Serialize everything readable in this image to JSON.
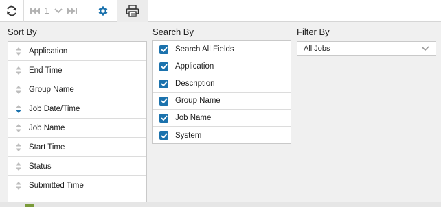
{
  "toolbar": {
    "page_number": "1",
    "icons": [
      "refresh-icon",
      "first-page-icon",
      "page-dropdown-icon",
      "last-page-icon",
      "gear-icon",
      "printer-icon"
    ],
    "accent_color": "#1b72ad"
  },
  "sort": {
    "title": "Sort By",
    "items": [
      {
        "label": "Application",
        "active": false
      },
      {
        "label": "End Time",
        "active": false
      },
      {
        "label": "Group Name",
        "active": false
      },
      {
        "label": "Job Date/Time",
        "active": true,
        "direction": "descending"
      },
      {
        "label": "Job Name",
        "active": false
      },
      {
        "label": "Start Time",
        "active": false
      },
      {
        "label": "Status",
        "active": false
      },
      {
        "label": "Submitted Time",
        "active": false
      }
    ]
  },
  "search": {
    "title": "Search By",
    "items": [
      {
        "label": "Search All Fields",
        "checked": true
      },
      {
        "label": "Application",
        "checked": true
      },
      {
        "label": "Description",
        "checked": true
      },
      {
        "label": "Group Name",
        "checked": true
      },
      {
        "label": "Job Name",
        "checked": true
      },
      {
        "label": "System",
        "checked": true
      }
    ]
  },
  "filter": {
    "title": "Filter By",
    "selected": "All Jobs"
  }
}
